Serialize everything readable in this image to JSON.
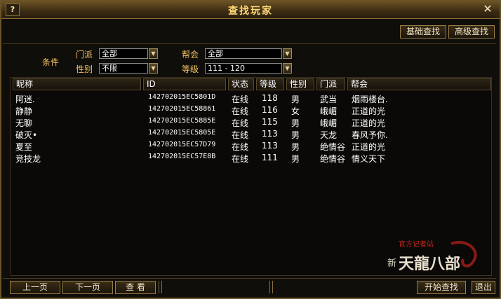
{
  "window": {
    "title": "查找玩家",
    "help_label": "?",
    "close_label": "✕"
  },
  "top_buttons": {
    "basic_search": "基础查找",
    "advanced_search": "高级查找"
  },
  "filters": {
    "condition_label": "条件",
    "sect_label": "门派",
    "sect_value": "全部",
    "gender_label": "性别",
    "gender_value": "不限",
    "guild_label": "帮会",
    "guild_value": "全部",
    "level_label": "等级",
    "level_value": "111 - 120"
  },
  "table": {
    "headers": [
      "昵称",
      "ID",
      "状态",
      "等级",
      "性别",
      "门派",
      "帮会"
    ],
    "rows": [
      {
        "name": "阿迷.",
        "id": "142702015EC5801D",
        "status": "在线",
        "level": "118",
        "gender": "男",
        "sect": "武当",
        "guild": "烟雨楼台."
      },
      {
        "name": "静静",
        "id": "142702015EC58861",
        "status": "在线",
        "level": "116",
        "gender": "女",
        "sect": "峨嵋",
        "guild": "正道的光"
      },
      {
        "name": "无聊",
        "id": "142702015EC5885E",
        "status": "在线",
        "level": "115",
        "gender": "男",
        "sect": "峨嵋",
        "guild": "正道的光"
      },
      {
        "name": "破灭•",
        "id": "142702015EC5805E",
        "status": "在线",
        "level": "113",
        "gender": "男",
        "sect": "天龙",
        "guild": "春风予你."
      },
      {
        "name": "夏至",
        "id": "142702015EC57D79",
        "status": "在线",
        "level": "113",
        "gender": "男",
        "sect": "绝情谷",
        "guild": "正道的光"
      },
      {
        "name": "竞技龙",
        "id": "142702015EC57E8B",
        "status": "在线",
        "level": "111",
        "gender": "男",
        "sect": "绝情谷",
        "guild": "情义天下"
      }
    ]
  },
  "bottom_buttons": {
    "prev_page": "上一页",
    "next_page": "下一页",
    "view": "查 看",
    "start_search": "开始查找",
    "exit": "退出"
  },
  "logo": {
    "subtitle": "官方记者站",
    "name": "天龍八部",
    "prefix": "新"
  },
  "colors": {
    "frame": "#6a5428",
    "title_text": "#ffd878",
    "label_text": "#f0c060",
    "logo_red": "#c0281e"
  }
}
